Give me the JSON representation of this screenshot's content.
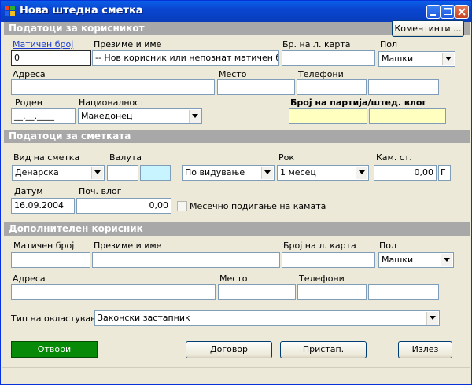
{
  "window": {
    "title": "Нова штедна сметка"
  },
  "section_user": {
    "title": "Податоци за корисникот",
    "comments_button": "Коментинти ...",
    "labels": {
      "embg": "Матичен број",
      "name": "Презиме и име",
      "idcard": "Бр. на л. карта",
      "gender": "Пол",
      "address": "Адреса",
      "place": "Место",
      "phones": "Телефони",
      "born": "Роден",
      "nationality": "Националност",
      "account_no": "Број на партија/штед. влог"
    },
    "values": {
      "embg": "0",
      "name": "-- Нов корисник или непознат матичен број --",
      "gender": "Машки",
      "born": "__.__.____",
      "nationality": "Македонец"
    }
  },
  "section_account": {
    "title": "Податоци за сметката",
    "labels": {
      "type": "Вид на сметка",
      "currency": "Валута",
      "term": "Рок",
      "rate": "Кам. ст.",
      "date": "Датум",
      "initial": "Поч. влог"
    },
    "values": {
      "type": "Денарска",
      "withdraw": "По видување",
      "term": "1 месец",
      "rate": "0,00",
      "rate_unit": "Г",
      "date": "16.09.2004",
      "initial": "0,00"
    },
    "monthly_interest_label": "Месечно подигање на камата"
  },
  "section_extra": {
    "title": "Дополнителен корисник",
    "labels": {
      "embg": "Матичен број",
      "name": "Презиме и име",
      "idcard": "Број на л. карта",
      "gender": "Пол",
      "address": "Адреса",
      "place": "Место",
      "phones": "Телефони",
      "authority": "Тип на овластување"
    },
    "values": {
      "gender": "Машки",
      "authority": "Законски застапник"
    }
  },
  "buttons": {
    "open": "Отвори",
    "contract": "Договор",
    "receipt": "Пристап.",
    "exit": "Излез"
  },
  "colors": {
    "titlebar": "#0a4fd8",
    "section_header": "#a8a8a8",
    "window_bg": "#ece9d8",
    "highlight_field": "#ffffc0",
    "currency_field": "#c8f4ff",
    "open_button": "#078a07"
  }
}
